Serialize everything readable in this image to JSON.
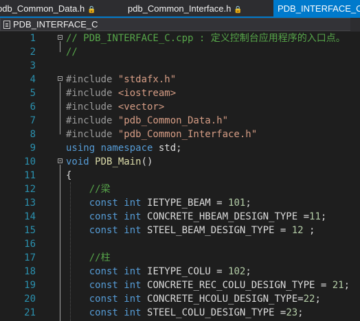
{
  "tabs": [
    {
      "label": "pdb_Common_Data.h",
      "locked": true
    },
    {
      "label": "pdb_Common_Interface.h",
      "locked": true
    },
    {
      "label": "PDB_INTERFACE_C.cpp",
      "active": true
    }
  ],
  "navbar": {
    "scope": "PDB_INTERFACE_C"
  },
  "lines": [
    {
      "n": "1",
      "parts": [
        {
          "t": "// PDB_INTERFACE_C.cpp : 定义控制台应用程序的入口点。",
          "c": "cmt"
        }
      ]
    },
    {
      "n": "2",
      "parts": [
        {
          "t": "//",
          "c": "cmt"
        }
      ]
    },
    {
      "n": "3",
      "parts": []
    },
    {
      "n": "4",
      "parts": [
        {
          "t": "#include ",
          "c": "pp"
        },
        {
          "t": "\"stdafx.h\"",
          "c": "str"
        }
      ]
    },
    {
      "n": "5",
      "parts": [
        {
          "t": "#include ",
          "c": "pp"
        },
        {
          "t": "<iostream>",
          "c": "str"
        }
      ]
    },
    {
      "n": "6",
      "parts": [
        {
          "t": "#include ",
          "c": "pp"
        },
        {
          "t": "<vector>",
          "c": "str"
        }
      ]
    },
    {
      "n": "7",
      "parts": [
        {
          "t": "#include ",
          "c": "pp"
        },
        {
          "t": "\"pdb_Common_Data.h\"",
          "c": "str"
        }
      ]
    },
    {
      "n": "8",
      "parts": [
        {
          "t": "#include ",
          "c": "pp"
        },
        {
          "t": "\"pdb_Common_Interface.h\"",
          "c": "str"
        }
      ]
    },
    {
      "n": "9",
      "parts": [
        {
          "t": "using ",
          "c": "kw"
        },
        {
          "t": "namespace ",
          "c": "kw"
        },
        {
          "t": "std;",
          "c": "ident"
        }
      ]
    },
    {
      "n": "10",
      "parts": [
        {
          "t": "void ",
          "c": "kw"
        },
        {
          "t": "PDB_Main",
          "c": "fn"
        },
        {
          "t": "()",
          "c": "ident"
        }
      ]
    },
    {
      "n": "11",
      "parts": [
        {
          "t": "{",
          "c": "ident"
        }
      ]
    },
    {
      "n": "12",
      "parts": [
        {
          "t": "    //梁",
          "c": "cmt"
        }
      ]
    },
    {
      "n": "13",
      "parts": [
        {
          "t": "    const ",
          "c": "kw"
        },
        {
          "t": "int ",
          "c": "kw"
        },
        {
          "t": "IETYPE_BEAM = ",
          "c": "ident"
        },
        {
          "t": "101",
          "c": "num"
        },
        {
          "t": ";",
          "c": "ident"
        }
      ]
    },
    {
      "n": "14",
      "parts": [
        {
          "t": "    const ",
          "c": "kw"
        },
        {
          "t": "int ",
          "c": "kw"
        },
        {
          "t": "CONCRETE_HBEAM_DESIGN_TYPE =",
          "c": "ident"
        },
        {
          "t": "11",
          "c": "num"
        },
        {
          "t": ";",
          "c": "ident"
        }
      ]
    },
    {
      "n": "15",
      "parts": [
        {
          "t": "    const ",
          "c": "kw"
        },
        {
          "t": "int ",
          "c": "kw"
        },
        {
          "t": "STEEL_BEAM_DESIGN_TYPE = ",
          "c": "ident"
        },
        {
          "t": "12",
          "c": "num"
        },
        {
          "t": " ;",
          "c": "ident"
        }
      ]
    },
    {
      "n": "16",
      "parts": []
    },
    {
      "n": "17",
      "parts": [
        {
          "t": "    //柱",
          "c": "cmt"
        }
      ]
    },
    {
      "n": "18",
      "parts": [
        {
          "t": "    const ",
          "c": "kw"
        },
        {
          "t": "int ",
          "c": "kw"
        },
        {
          "t": "IETYPE_COLU = ",
          "c": "ident"
        },
        {
          "t": "102",
          "c": "num"
        },
        {
          "t": ";",
          "c": "ident"
        }
      ]
    },
    {
      "n": "19",
      "parts": [
        {
          "t": "    const ",
          "c": "kw"
        },
        {
          "t": "int ",
          "c": "kw"
        },
        {
          "t": "CONCRETE_REC_COLU_DESIGN_TYPE = ",
          "c": "ident"
        },
        {
          "t": "21",
          "c": "num"
        },
        {
          "t": ";",
          "c": "ident"
        }
      ]
    },
    {
      "n": "20",
      "parts": [
        {
          "t": "    const ",
          "c": "kw"
        },
        {
          "t": "int ",
          "c": "kw"
        },
        {
          "t": "CONCRETE_HCOLU_DESIGN_TYPE=",
          "c": "ident"
        },
        {
          "t": "22",
          "c": "num"
        },
        {
          "t": ";",
          "c": "ident"
        }
      ]
    },
    {
      "n": "21",
      "parts": [
        {
          "t": "    const ",
          "c": "kw"
        },
        {
          "t": "int ",
          "c": "kw"
        },
        {
          "t": "STEEL_COLU_DESIGN_TYPE =",
          "c": "ident"
        },
        {
          "t": "23",
          "c": "num"
        },
        {
          "t": ";",
          "c": "ident"
        }
      ]
    }
  ]
}
